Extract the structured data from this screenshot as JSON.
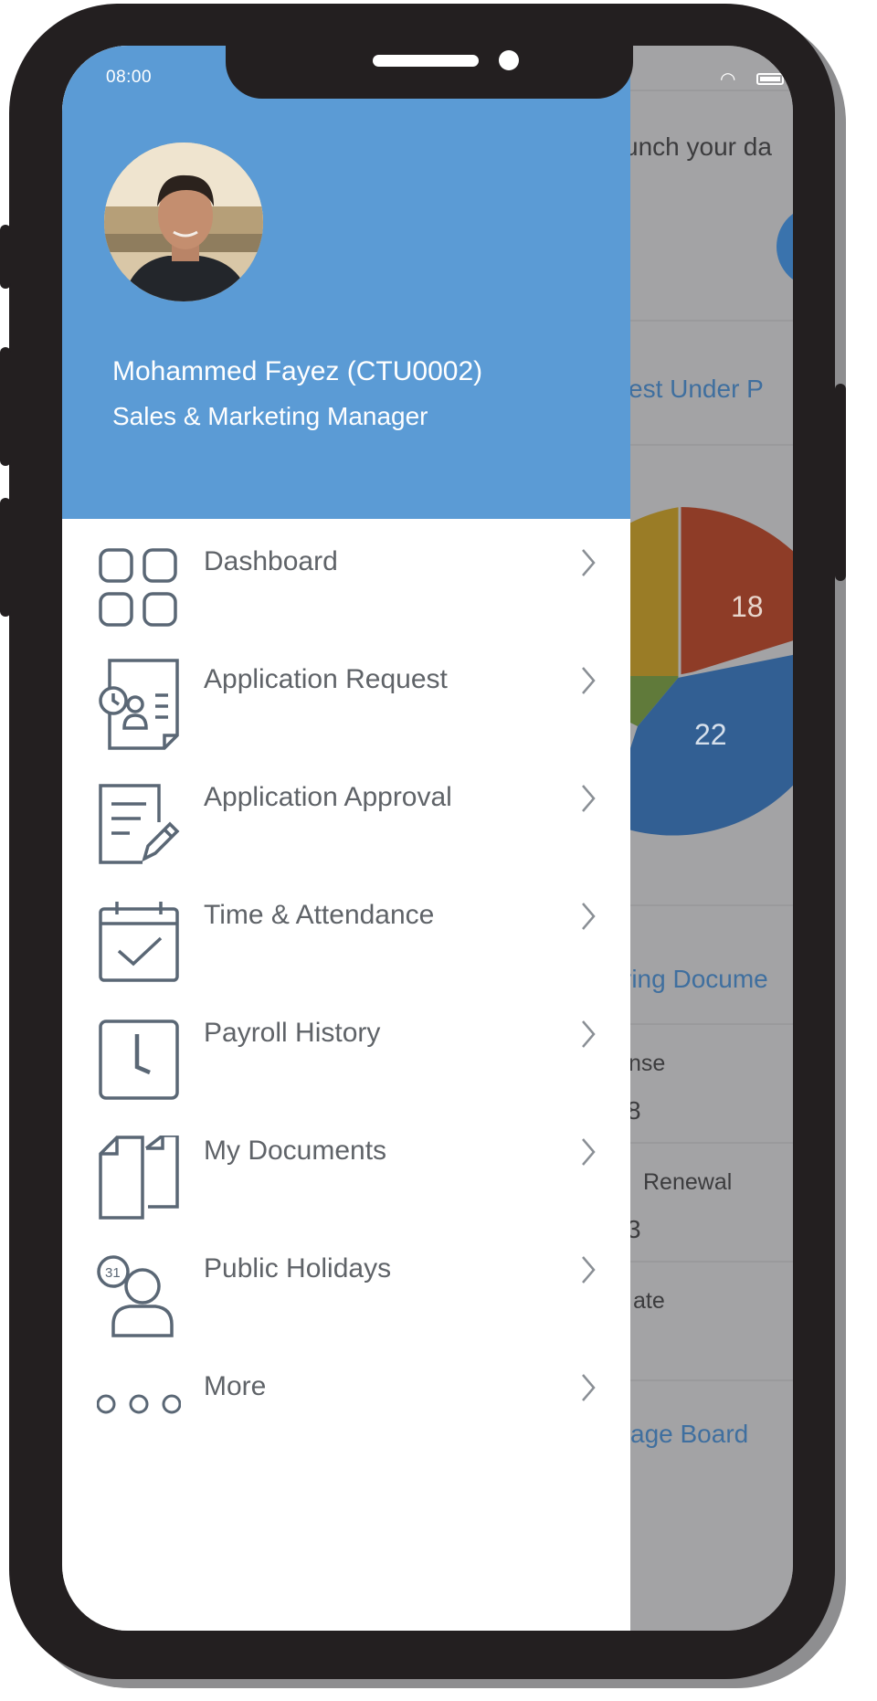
{
  "status_bar": {
    "time": "08:00"
  },
  "user": {
    "name": "Mohammed Fayez (CTU0002)",
    "role": "Sales & Marketing Manager"
  },
  "menu": {
    "items": [
      {
        "label": "Dashboard",
        "icon": "dashboard-grid-icon"
      },
      {
        "label": "Application Request",
        "icon": "application-request-icon"
      },
      {
        "label": "Application Approval",
        "icon": "application-approval-icon"
      },
      {
        "label": "Time & Attendance",
        "icon": "calendar-check-icon"
      },
      {
        "label": "Payroll History",
        "icon": "clock-icon"
      },
      {
        "label": "My Documents",
        "icon": "documents-icon"
      },
      {
        "label": "Public Holidays",
        "icon": "public-holidays-icon"
      },
      {
        "label": "More",
        "icon": "more-dots-icon"
      }
    ]
  },
  "background_screen": {
    "fragments": [
      "unch your da",
      "est Under P",
      "ring Docume",
      "nse",
      "8",
      "Renewal",
      "3",
      "ate",
      "age Board"
    ],
    "chart_values": [
      "18",
      "22"
    ],
    "colors": {
      "red": "#8e3c27",
      "blue": "#325f93",
      "mustard": "#9a7c26",
      "green": "#607a3a"
    }
  },
  "colors": {
    "header_blue": "#5b9bd5",
    "menu_text": "#5f6368",
    "icon_stroke": "#5a6775"
  }
}
